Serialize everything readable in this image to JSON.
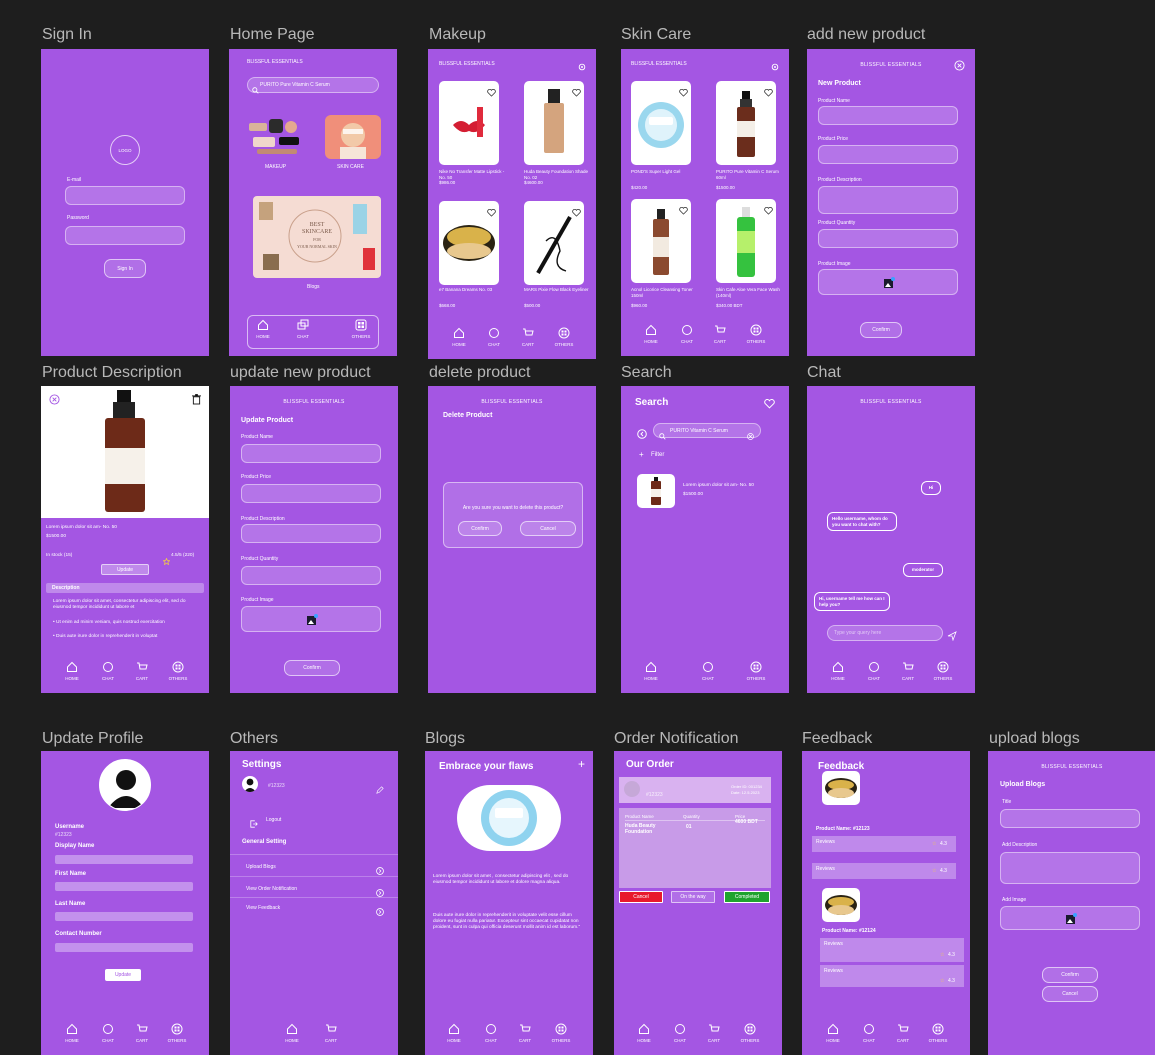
{
  "titles": {
    "signin": "Sign In",
    "home": "Home Page",
    "makeup": "Makeup",
    "skincare": "Skin Care",
    "add": "add new product",
    "desc": "Product Description",
    "update": "update new product",
    "delete": "delete product",
    "search": "Search",
    "chat": "Chat",
    "profile": "Update Profile",
    "others": "Others",
    "blogs": "Blogs",
    "order": "Order Notification",
    "feedback": "Feedback",
    "upload": "upload blogs"
  },
  "brand": "BLISSFUL ESSENTIALS",
  "nav": {
    "home": "HOME",
    "chat": "CHAT",
    "cart": "CART",
    "others": "OTHERS"
  },
  "signin": {
    "logo": "LOGO",
    "email": "E-mail",
    "password": "Password",
    "button": "Sign In"
  },
  "home": {
    "search": "PURITO Pure Vitamin C Serum",
    "makeup": "MAKEUP",
    "skincare": "SKIN CARE",
    "blogs": "Blogs",
    "banner1": "BEST",
    "banner2": "SKINCARE",
    "banner3": "FOR",
    "banner4": "YOUR NORMAL SKIN"
  },
  "makeup": {
    "products": [
      {
        "name": "Nike No Transfer Matte Lipstick - No. 50",
        "price": "$986.00"
      },
      {
        "name": "Huda Beauty Foundation Shade No. 02",
        "price": "$4600.00"
      },
      {
        "name": "e7 Banana Dreams No. 03",
        "price": "$668.00"
      },
      {
        "name": "MARS Pixie Flow Black Eyeliner",
        "price": "$500.00"
      }
    ]
  },
  "skincare": {
    "products": [
      {
        "name": "POND'S Super Light Gel",
        "price": "$420.00"
      },
      {
        "name": "PURITO Pure Vitamin C Serum 60ml",
        "price": "$1500.00"
      },
      {
        "name": "Acnol Licorice Cleansing Toner 150ml",
        "price": "$960.00"
      },
      {
        "name": "Skin Cafe Aloe Vera Face Wash (140ml)",
        "price": "$340.00 BDT"
      }
    ]
  },
  "add": {
    "heading": "New Product",
    "name": "Product Name",
    "price": "Product Price",
    "description": "Product Description",
    "quantity": "Product Quantity",
    "image": "Product Image",
    "confirm": "Confirm"
  },
  "desc": {
    "name": "Lorem ipsum dolor sit am- No. 50",
    "price": "$1500.00",
    "stock": "In stock (15)",
    "rating": "4.5/5 (220)",
    "update": "Update",
    "heading": "Description",
    "body": "Lorem ipsum dolor sit amet, consectetur adipiscing elit, sed do eiusmod tempor incididunt ut labore et",
    "bullet1": "Ut enim ad minim veniam, quis nostrud exercitation",
    "bullet2": "Duis aute irure dolor in reprehenderit in voluptat"
  },
  "update": {
    "heading": "Update Product",
    "name": "Product Name",
    "price": "Product Price",
    "description": "Product Description",
    "quantity": "Product Quantity",
    "image": "Product Image",
    "confirm": "Confirm"
  },
  "delete": {
    "heading": "Delete Product",
    "question": "Are you sure you want to delete this product?",
    "confirm": "Confirm",
    "cancel": "Cancel"
  },
  "search": {
    "heading": "Search",
    "query": "PURITO Vitamin C Serum",
    "filter": "Filter",
    "result_name": "Lorem ipsum dolor sit am- No. 50",
    "result_price": "$1500.00"
  },
  "chat": {
    "msg1": "Hi",
    "msg2": "Hello username, whom do you want to chat with?",
    "msg3": "moderator",
    "msg4": "Hi, username tell me how can I help you?",
    "placeholder": "Type your query here"
  },
  "profile": {
    "username_label": "Username",
    "username": "#12323",
    "display": "Display Name",
    "first": "First Name",
    "last": "Last Name",
    "contact": "Contact Number",
    "update": "Update"
  },
  "others": {
    "heading": "Settings",
    "user": "#12323",
    "logout": "Logout",
    "general": "General Setting",
    "upload": "Upload Blogs",
    "orders": "View Order Notification",
    "feedback": "View Feedback",
    "home": "HOME",
    "cart": "CART"
  },
  "blogs": {
    "heading": "Embrace your flaws",
    "p1": "Lorem ipsum dolor sit amet , consectetur adipiscing elit , sed do eiusmod tempor incididunt ut labore et dolore magna aliqua.",
    "p2": "Duis aute irure dolor in reprehenderit in voluptate velit esse cillum dolore eu fugiat nulla pariatur. Excepteur sint occaecat cupidatat non proident, sunt in culpa qui officia deserunt mollit anim id est laborum.\""
  },
  "order": {
    "heading": "Our Order",
    "user": "#12323",
    "order_id": "Order ID: 001234",
    "date": "Date: 12.5.2023",
    "col_name": "Product Name",
    "col_qty": "Quantity",
    "col_price": "Price",
    "prod": "Huda Beauty Foundation",
    "qty": "01",
    "price": "4600 BDT",
    "cancel": "Cancel",
    "onway": "On the way",
    "completed": "Completed",
    "cancel_color": "#e8192c",
    "completed_color": "#1fa32e"
  },
  "feedback": {
    "heading": "Feedback",
    "prod1": "Product Name: #12123",
    "prod2": "Product Name: #12124",
    "reviews": "Reviews",
    "r1": "4.3",
    "r2": "4.3",
    "r3": "4.3",
    "r4": "4.3"
  },
  "upload": {
    "heading": "Upload Blogs",
    "title": "Title",
    "description": "Add Description",
    "image": "Add Image",
    "confirm": "Confirm",
    "cancel": "Cancel"
  }
}
